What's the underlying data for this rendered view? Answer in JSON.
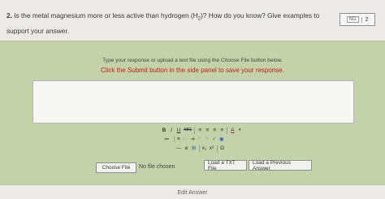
{
  "question": {
    "number": "2.",
    "line1": "Is the metal magnesium more or less active than hydrogen (H",
    "subscript": "2",
    "line1_end": ")? How do you know? Give examples to",
    "line2": "support your answer."
  },
  "score": {
    "badge": "NG",
    "value": "2"
  },
  "panel": {
    "instruction": "Type your response or upload a text file using the Choose File button below.",
    "submit_notice": "Click the Submit button in the side panel to save your response.",
    "textarea_value": ""
  },
  "toolbar": {
    "row1": [
      "B",
      "I",
      "U",
      "ABC",
      "≡",
      "≡",
      "≡",
      "≡",
      "A",
      "▾"
    ],
    "row2": [
      "≔",
      "⋮≡",
      "⇤",
      "⇥",
      "↶",
      "↷",
      "✓",
      "◉"
    ],
    "row3": [
      "—",
      "⌀",
      "⊞",
      "x₂",
      "x²",
      "Ω"
    ]
  },
  "file": {
    "choose_label": "Choose File",
    "no_file": "No file chosen",
    "load_txt": "Load a TXT File",
    "load_prev": "Load a Previous Answer"
  },
  "footer": {
    "edit_answer": "Edit Answer"
  }
}
